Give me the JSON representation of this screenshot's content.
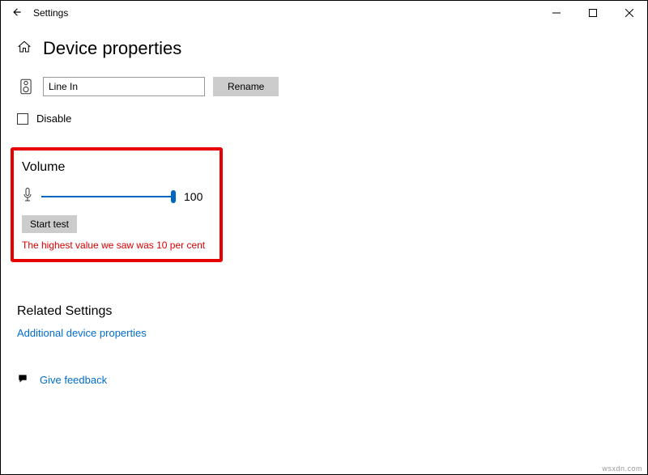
{
  "titlebar": {
    "title": "Settings"
  },
  "header": {
    "title": "Device properties"
  },
  "device": {
    "name_value": "Line In",
    "rename_label": "Rename"
  },
  "disable": {
    "label": "Disable",
    "checked": false
  },
  "volume": {
    "title": "Volume",
    "value": "100",
    "start_test_label": "Start test",
    "status_text": "The highest value we saw was 10 per cent"
  },
  "related": {
    "title": "Related Settings",
    "link1": "Additional device properties"
  },
  "feedback": {
    "label": "Give feedback"
  },
  "watermark": "wsxdn.com"
}
